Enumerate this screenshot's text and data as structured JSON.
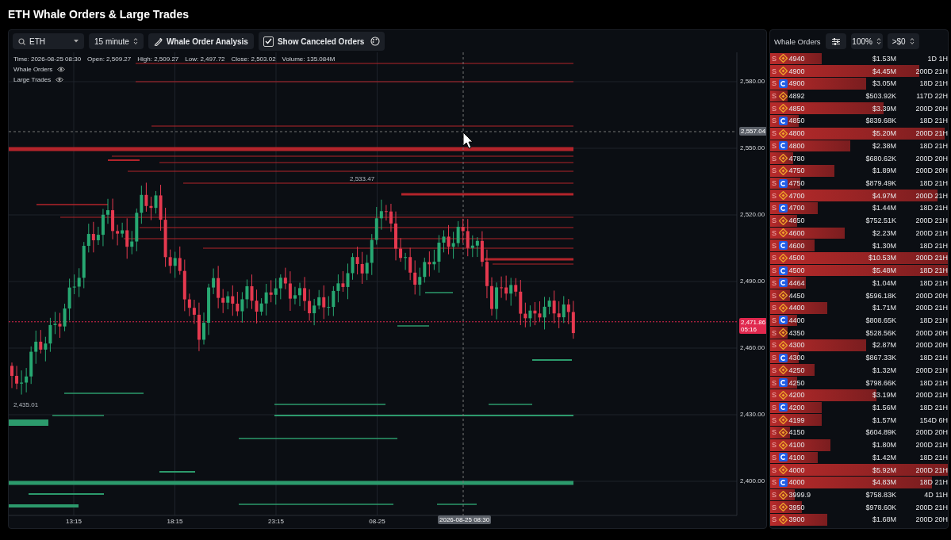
{
  "page": {
    "title": "ETH Whale Orders & Large Trades"
  },
  "toolbar": {
    "symbol": {
      "value": "ETH"
    },
    "interval": {
      "value": "15 minute"
    },
    "analysis_button": "Whale Order Analysis",
    "show_canceled": {
      "label": "Show Canceled Orders",
      "checked": true
    }
  },
  "chart": {
    "info": [
      "Time: 2026-08-25 08:30",
      "Open: 2,509.27",
      "High: 2,509.27",
      "Low: 2,497.72",
      "Close: 2,503.02",
      "Volume: 135.084M"
    ],
    "legend": [
      {
        "label": "Whale Orders",
        "visible": true
      },
      {
        "label": "Large Trades",
        "visible": true
      }
    ],
    "yticks": [
      "2,580.00",
      "2,550.00",
      "2,520.00",
      "2,490.00",
      "2,460.00",
      "2,430.00",
      "2,400.00"
    ],
    "xticks": [
      "13:15",
      "18:15",
      "23:15",
      "08-25"
    ],
    "high_label": "2,533.47",
    "low_label": "2,435.01",
    "crosshair": {
      "price": "2,557.04",
      "time": "2026-08-25 08:30"
    },
    "last_price": {
      "price": "2,471.86",
      "countdown": "05:16"
    }
  },
  "orders_panel": {
    "title": "Whale Orders",
    "zoom": "100%",
    "filter": ">$0",
    "rows": [
      {
        "side": "S",
        "kind": "binance",
        "price": "4940",
        "amount": "$1.53M",
        "age": "1D 1H",
        "level": 0.29
      },
      {
        "side": "S",
        "kind": "binance",
        "price": "4900",
        "amount": "$4.45M",
        "age": "200D 21H",
        "level": 0.84
      },
      {
        "side": "S",
        "kind": "coinbase",
        "price": "4900",
        "amount": "$3.05M",
        "age": "18D 21H",
        "level": 0.54
      },
      {
        "side": "S",
        "kind": "binance",
        "price": "4892",
        "amount": "$503.92K",
        "age": "117D 22H",
        "level": 0.1
      },
      {
        "side": "S",
        "kind": "binance",
        "price": "4850",
        "amount": "$3.39M",
        "age": "200D 20H",
        "level": 0.64
      },
      {
        "side": "S",
        "kind": "coinbase",
        "price": "4850",
        "amount": "$839.68K",
        "age": "18D 21H",
        "level": 0.16
      },
      {
        "side": "S",
        "kind": "binance",
        "price": "4800",
        "amount": "$5.20M",
        "age": "200D 21H",
        "level": 0.98
      },
      {
        "side": "S",
        "kind": "coinbase",
        "price": "4800",
        "amount": "$2.38M",
        "age": "18D 21H",
        "level": 0.45
      },
      {
        "side": "S",
        "kind": "binance",
        "price": "4780",
        "amount": "$680.62K",
        "age": "200D 20H",
        "level": 0.13
      },
      {
        "side": "S",
        "kind": "binance",
        "price": "4750",
        "amount": "$1.89M",
        "age": "200D 20H",
        "level": 0.36
      },
      {
        "side": "S",
        "kind": "coinbase",
        "price": "4750",
        "amount": "$879.49K",
        "age": "18D 21H",
        "level": 0.17
      },
      {
        "side": "S",
        "kind": "binance",
        "price": "4700",
        "amount": "$4.97M",
        "age": "200D 21H",
        "level": 0.94
      },
      {
        "side": "S",
        "kind": "coinbase",
        "price": "4700",
        "amount": "$1.44M",
        "age": "18D 21H",
        "level": 0.27
      },
      {
        "side": "S",
        "kind": "binance",
        "price": "4650",
        "amount": "$752.51K",
        "age": "200D 21H",
        "level": 0.15
      },
      {
        "side": "S",
        "kind": "binance",
        "price": "4600",
        "amount": "$2.23M",
        "age": "200D 21H",
        "level": 0.42
      },
      {
        "side": "S",
        "kind": "coinbase",
        "price": "4600",
        "amount": "$1.30M",
        "age": "18D 21H",
        "level": 0.25
      },
      {
        "side": "S",
        "kind": "binance",
        "price": "4500",
        "amount": "$10.53M",
        "age": "200D 21H",
        "level": 1
      },
      {
        "side": "S",
        "kind": "coinbase",
        "price": "4500",
        "amount": "$5.48M",
        "age": "18D 21H",
        "level": 1
      },
      {
        "side": "S",
        "kind": "coinbase",
        "price": "4464",
        "amount": "$1.04M",
        "age": "18D 21H",
        "level": 0.2
      },
      {
        "side": "S",
        "kind": "binance",
        "price": "4450",
        "amount": "$596.18K",
        "age": "200D 20H",
        "level": 0.11
      },
      {
        "side": "S",
        "kind": "binance",
        "price": "4400",
        "amount": "$1.71M",
        "age": "200D 21H",
        "level": 0.32
      },
      {
        "side": "S",
        "kind": "coinbase",
        "price": "4400",
        "amount": "$808.65K",
        "age": "18D 21H",
        "level": 0.15
      },
      {
        "side": "S",
        "kind": "binance",
        "price": "4350",
        "amount": "$528.56K",
        "age": "200D 20H",
        "level": 0.1
      },
      {
        "side": "S",
        "kind": "binance",
        "price": "4300",
        "amount": "$2.87M",
        "age": "200D 20H",
        "level": 0.54
      },
      {
        "side": "S",
        "kind": "coinbase",
        "price": "4300",
        "amount": "$867.33K",
        "age": "18D 21H",
        "level": 0.16
      },
      {
        "side": "S",
        "kind": "binance",
        "price": "4250",
        "amount": "$1.32M",
        "age": "200D 21H",
        "level": 0.25
      },
      {
        "side": "S",
        "kind": "coinbase",
        "price": "4250",
        "amount": "$798.66K",
        "age": "18D 21H",
        "level": 0.15
      },
      {
        "side": "S",
        "kind": "binance",
        "price": "4200",
        "amount": "$3.19M",
        "age": "200D 21H",
        "level": 0.6
      },
      {
        "side": "S",
        "kind": "coinbase",
        "price": "4200",
        "amount": "$1.56M",
        "age": "18D 21H",
        "level": 0.29
      },
      {
        "side": "S",
        "kind": "binance",
        "price": "4199",
        "amount": "$1.57M",
        "age": "154D 6H",
        "level": 0.29
      },
      {
        "side": "S",
        "kind": "binance",
        "price": "4150",
        "amount": "$604.89K",
        "age": "200D 20H",
        "level": 0.11
      },
      {
        "side": "S",
        "kind": "binance",
        "price": "4100",
        "amount": "$1.80M",
        "age": "200D 21H",
        "level": 0.34
      },
      {
        "side": "S",
        "kind": "coinbase",
        "price": "4100",
        "amount": "$1.42M",
        "age": "18D 21H",
        "level": 0.27
      },
      {
        "side": "S",
        "kind": "binance",
        "price": "4000",
        "amount": "$5.92M",
        "age": "200D 21H",
        "level": 1
      },
      {
        "side": "S",
        "kind": "coinbase",
        "price": "4000",
        "amount": "$4.83M",
        "age": "18D 21H",
        "level": 0.91
      },
      {
        "side": "S",
        "kind": "binance",
        "price": "3999.9",
        "amount": "$758.83K",
        "age": "4D 11H",
        "level": 0.14
      },
      {
        "side": "S",
        "kind": "binance",
        "price": "3950",
        "amount": "$978.60K",
        "age": "200D 21H",
        "level": 0.18
      },
      {
        "side": "S",
        "kind": "binance",
        "price": "3900",
        "amount": "$1.68M",
        "age": "200D 20H",
        "level": 0.32
      }
    ]
  }
}
